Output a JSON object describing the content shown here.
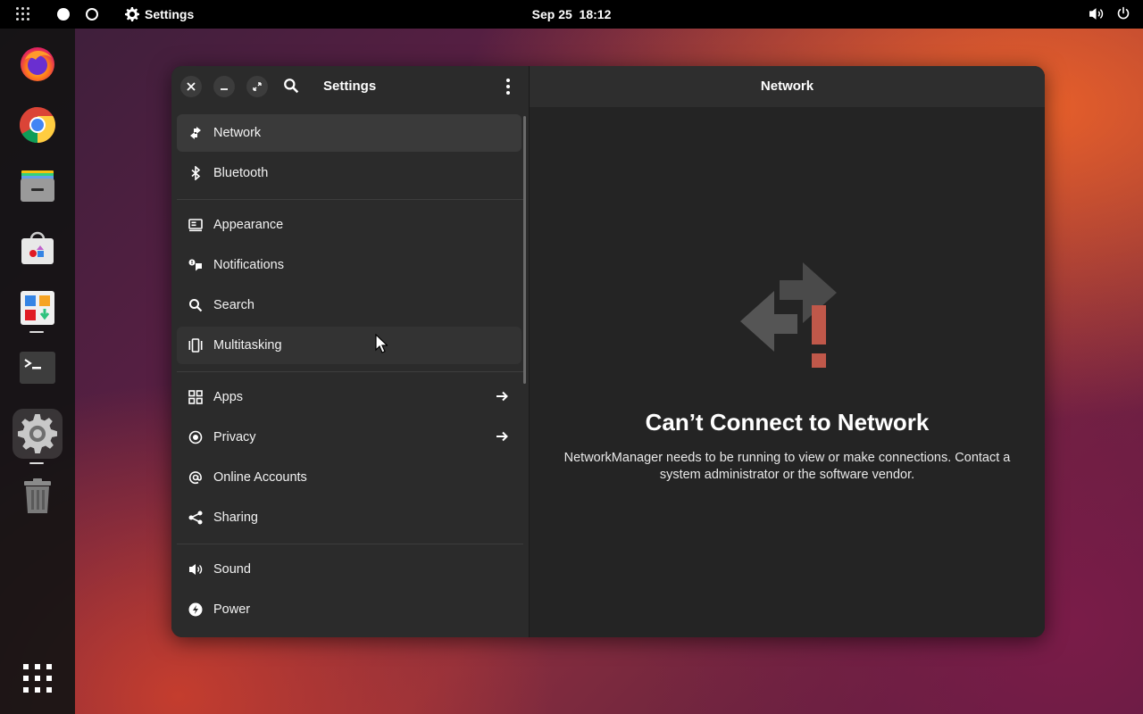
{
  "topbar": {
    "app_name": "Settings",
    "date": "Sep 25",
    "time": "18:12",
    "icons": [
      "apps-grid-icon",
      "volume-icon",
      "power-icon"
    ]
  },
  "dock": {
    "items": [
      "firefox",
      "chrome",
      "files",
      "app-center",
      "software-updater",
      "terminal",
      "settings",
      "trash",
      "show-apps"
    ]
  },
  "window": {
    "sidebar_title": "Settings",
    "content_title": "Network",
    "nav": [
      {
        "label": "Network",
        "icon": "network-icon",
        "selected": true
      },
      {
        "label": "Bluetooth",
        "icon": "bluetooth-icon"
      },
      {
        "label": "Appearance",
        "icon": "appearance-icon"
      },
      {
        "label": "Notifications",
        "icon": "notifications-icon"
      },
      {
        "label": "Search",
        "icon": "search-icon"
      },
      {
        "label": "Multitasking",
        "icon": "multitasking-icon"
      },
      {
        "label": "Apps",
        "icon": "apps-icon",
        "has_arrow": true
      },
      {
        "label": "Privacy",
        "icon": "privacy-icon",
        "has_arrow": true
      },
      {
        "label": "Online Accounts",
        "icon": "at-icon"
      },
      {
        "label": "Sharing",
        "icon": "share-icon"
      },
      {
        "label": "Sound",
        "icon": "sound-icon"
      },
      {
        "label": "Power",
        "icon": "power-icon"
      }
    ]
  },
  "error": {
    "title": "Can’t Connect to Network",
    "description": "NetworkManager needs to be running to view or make connections. Contact a system administrator or the software vendor."
  },
  "colors": {
    "accent_error": "#c0584a",
    "window_bg": "#242424",
    "sidebar_bg": "#2b2b2b"
  }
}
